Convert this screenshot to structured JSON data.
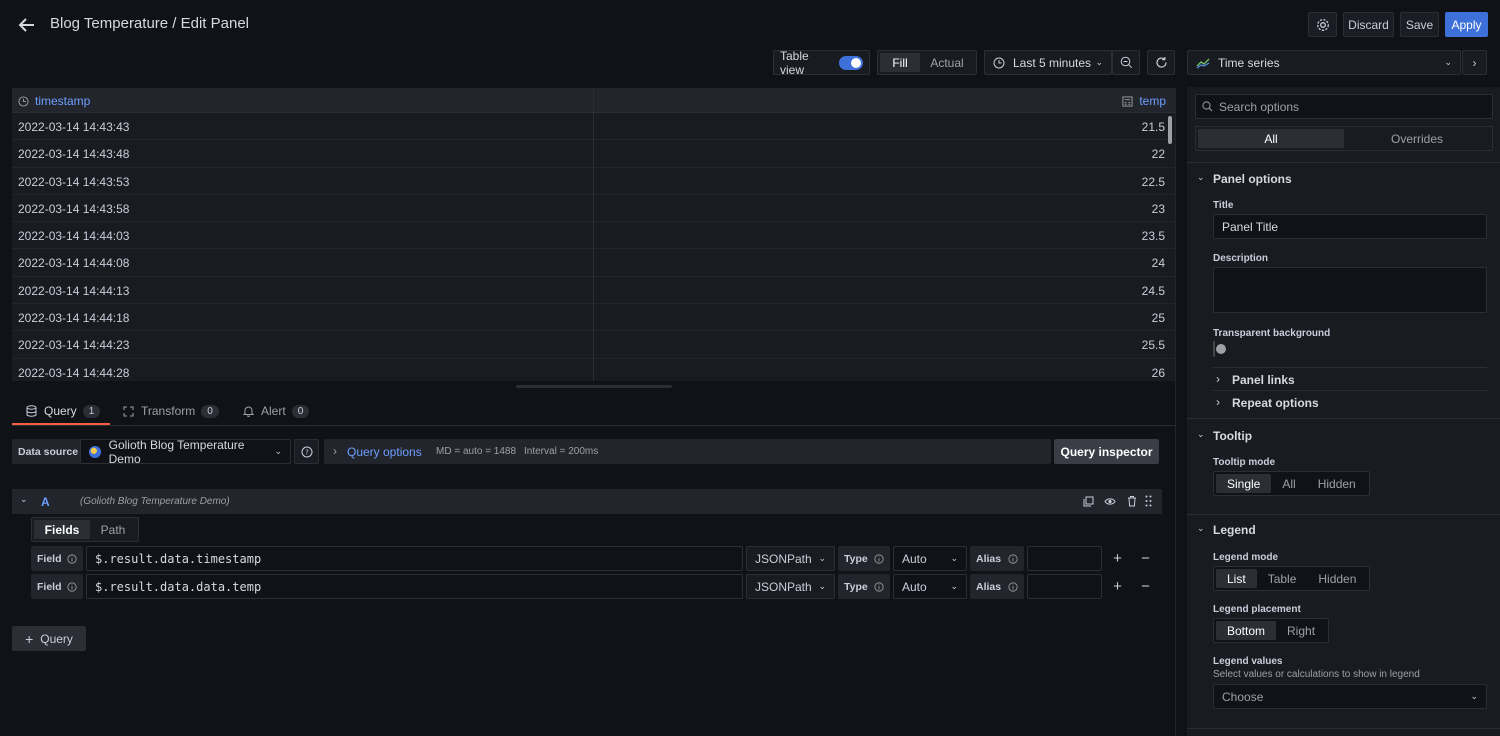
{
  "header": {
    "title": "Blog Temperature / Edit Panel",
    "discard": "Discard",
    "save": "Save",
    "apply": "Apply"
  },
  "toolbar": {
    "table_view": "Table view",
    "fill": "Fill",
    "actual": "Actual",
    "time_range": "Last 5 minutes",
    "visualization": "Time series"
  },
  "table": {
    "col_timestamp": "timestamp",
    "col_temp": "temp",
    "rows": [
      {
        "ts": "2022-03-14 14:43:43",
        "temp": "21.5"
      },
      {
        "ts": "2022-03-14 14:43:48",
        "temp": "22"
      },
      {
        "ts": "2022-03-14 14:43:53",
        "temp": "22.5"
      },
      {
        "ts": "2022-03-14 14:43:58",
        "temp": "23"
      },
      {
        "ts": "2022-03-14 14:44:03",
        "temp": "23.5"
      },
      {
        "ts": "2022-03-14 14:44:08",
        "temp": "24"
      },
      {
        "ts": "2022-03-14 14:44:13",
        "temp": "24.5"
      },
      {
        "ts": "2022-03-14 14:44:18",
        "temp": "25"
      },
      {
        "ts": "2022-03-14 14:44:23",
        "temp": "25.5"
      },
      {
        "ts": "2022-03-14 14:44:28",
        "temp": "26"
      }
    ]
  },
  "tabs": {
    "query": "Query",
    "query_count": "1",
    "transform": "Transform",
    "transform_count": "0",
    "alert": "Alert",
    "alert_count": "0"
  },
  "query": {
    "data_source_label": "Data source",
    "data_source": "Golioth Blog Temperature Demo",
    "query_options": "Query options",
    "md": "MD = auto = 1488",
    "interval": "Interval = 200ms",
    "inspector": "Query inspector",
    "ref_id": "A",
    "ref_source": "(Golioth Blog Temperature Demo)",
    "fields_tab": "Fields",
    "path_tab": "Path",
    "field_label": "Field",
    "type_label": "Type",
    "alias_label": "Alias",
    "fields": [
      {
        "path": "$.result.data.timestamp",
        "kind": "JSONPath",
        "type": "Auto"
      },
      {
        "path": "$.result.data.data.temp",
        "kind": "JSONPath",
        "type": "Auto"
      }
    ],
    "add_query": "Query"
  },
  "options": {
    "search_placeholder": "Search options",
    "all": "All",
    "overrides": "Overrides",
    "panel_options": "Panel options",
    "title_label": "Title",
    "title_value": "Panel Title",
    "description_label": "Description",
    "transparent_label": "Transparent background",
    "panel_links": "Panel links",
    "repeat_options": "Repeat options",
    "tooltip": "Tooltip",
    "tooltip_mode": "Tooltip mode",
    "tooltip_modes": [
      "Single",
      "All",
      "Hidden"
    ],
    "legend": "Legend",
    "legend_mode": "Legend mode",
    "legend_modes": [
      "List",
      "Table",
      "Hidden"
    ],
    "legend_placement": "Legend placement",
    "legend_placements": [
      "Bottom",
      "Right"
    ],
    "legend_values": "Legend values",
    "legend_values_desc": "Select values or calculations to show in legend",
    "choose": "Choose"
  }
}
